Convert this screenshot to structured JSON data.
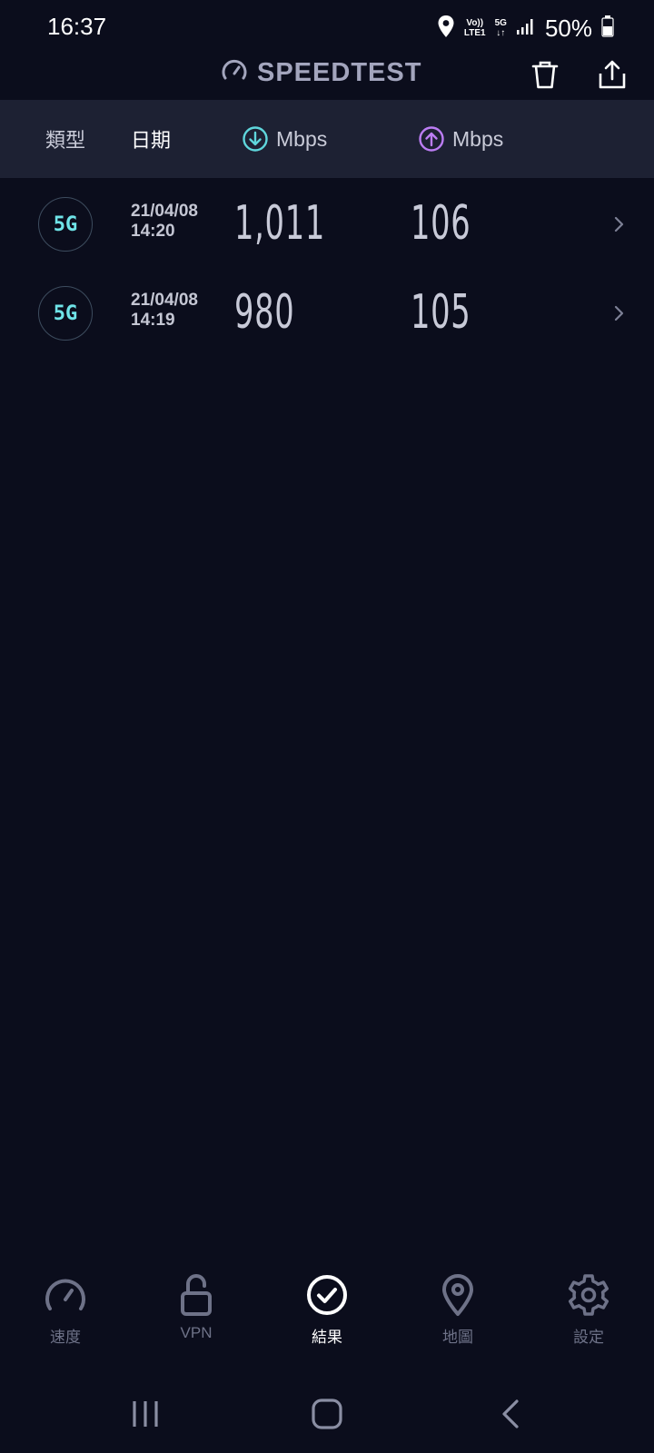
{
  "status": {
    "time": "16:37",
    "volte_top": "Vo))",
    "volte_bottom": "LTE1",
    "network": "5G",
    "network_arrows": "↓↑",
    "battery": "50%"
  },
  "app": {
    "title": "SPEEDTEST"
  },
  "columns": {
    "type": "類型",
    "date": "日期",
    "download_unit": "Mbps",
    "upload_unit": "Mbps"
  },
  "colors": {
    "download": "#5fd6dc",
    "upload": "#bc7df4",
    "badge": "#6fe4e8",
    "background": "#0b0d1c",
    "header": "#1d2133"
  },
  "results": [
    {
      "type": "5G",
      "date": "21/04/08",
      "time": "14:20",
      "download": "1,011",
      "upload": "106"
    },
    {
      "type": "5G",
      "date": "21/04/08",
      "time": "14:19",
      "download": "980",
      "upload": "105"
    }
  ],
  "nav": [
    {
      "label": "速度",
      "icon": "speedometer-icon"
    },
    {
      "label": "VPN",
      "icon": "unlock-icon"
    },
    {
      "label": "結果",
      "icon": "check-circle-icon"
    },
    {
      "label": "地圖",
      "icon": "map-pin-icon"
    },
    {
      "label": "設定",
      "icon": "gear-icon"
    }
  ]
}
